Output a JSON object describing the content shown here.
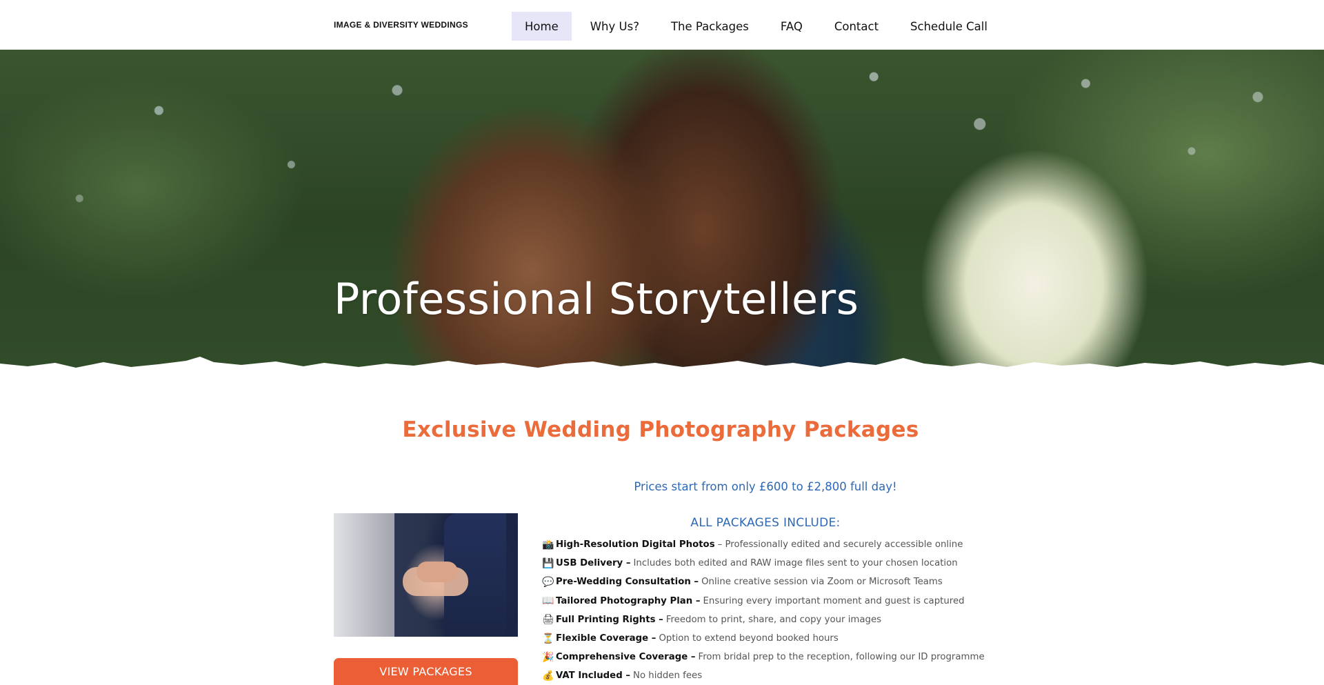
{
  "header": {
    "logo": "IMAGE & DIVERSITY WEDDINGS",
    "nav": [
      {
        "label": "Home",
        "active": true
      },
      {
        "label": "Why Us?",
        "active": false
      },
      {
        "label": "The Packages",
        "active": false
      },
      {
        "label": "FAQ",
        "active": false
      },
      {
        "label": "Contact",
        "active": false
      },
      {
        "label": "Schedule Call",
        "active": false
      }
    ]
  },
  "hero": {
    "title": "Professional Storytellers"
  },
  "main": {
    "section_title": "Exclusive Wedding Photography Packages",
    "prices_text": "Prices start from only £600 to £2,800 full day!",
    "view_packages_label": "VIEW PACKAGES",
    "includes_heading": "ALL PACKAGES INCLUDE:",
    "includes": [
      {
        "icon": "📸",
        "icon_name": "camera-flash-icon",
        "title": "High-Resolution Digital Photos",
        "text": "– Professionally edited and securely accessible online"
      },
      {
        "icon": "💾",
        "icon_name": "floppy-disk-icon",
        "title": "USB Delivery –",
        "text": "Includes both edited and RAW image files sent to your chosen location"
      },
      {
        "icon": "💬",
        "icon_name": "speech-bubble-icon",
        "title": "Pre-Wedding Consultation –",
        "text": "Online creative session via Zoom or Microsoft Teams"
      },
      {
        "icon": "📖",
        "icon_name": "open-book-icon",
        "title": "Tailored Photography Plan –",
        "text": "Ensuring every important moment and guest is captured"
      },
      {
        "icon": "🖨",
        "icon_name": "printer-icon",
        "title": "Full Printing Rights –",
        "text": "Freedom to print, share, and copy your images"
      },
      {
        "icon": "⏳",
        "icon_name": "hourglass-icon",
        "title": "Flexible Coverage –",
        "text": "Option to extend beyond booked hours"
      },
      {
        "icon": "🎉",
        "icon_name": "party-popper-icon",
        "title": "Comprehensive Coverage –",
        "text": "From bridal prep to the reception, following our ID programme"
      },
      {
        "icon": "💰",
        "icon_name": "money-bag-icon",
        "title": "VAT Included –",
        "text": "No hidden fees"
      }
    ]
  },
  "colors": {
    "accent_orange": "#eb6b3b",
    "button_orange": "#ec5e35",
    "link_blue": "#2c68b5",
    "nav_active_bg": "#e6e6f8"
  }
}
